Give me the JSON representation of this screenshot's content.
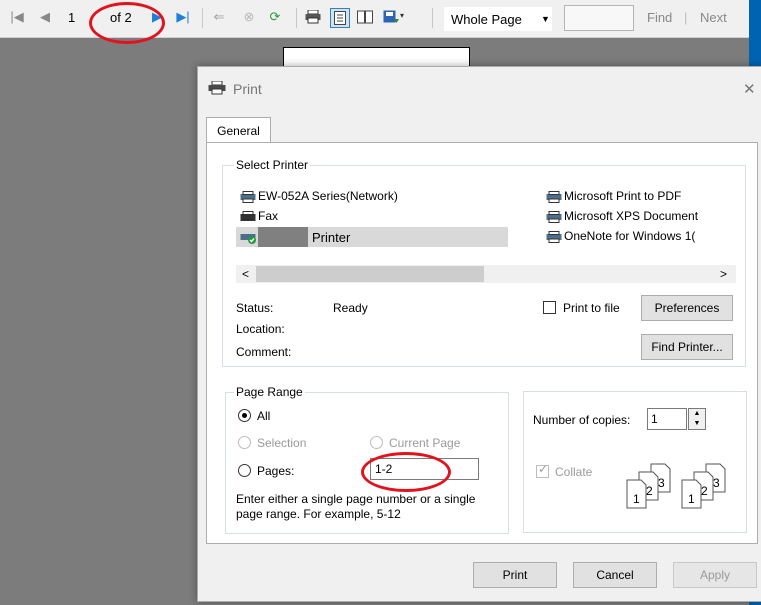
{
  "toolbar": {
    "page_number": "1",
    "page_of": "of 2",
    "zoom_select": "Whole Page",
    "search_value": "",
    "find_label": "Find",
    "separator": "|",
    "next_label": "Next"
  },
  "dialog": {
    "title": "Print",
    "close_glyph": "✕",
    "tab_general": "General",
    "select_printer_group": "Select Printer",
    "printers_left": [
      "EW-052A Series(Network)",
      "Fax",
      "Printer"
    ],
    "printers_right": [
      "Microsoft Print to PDF",
      "Microsoft XPS Document",
      "OneNote for Windows 1("
    ],
    "scroll_left": "<",
    "scroll_right": ">",
    "status_label": "Status:",
    "status_value": "Ready",
    "location_label": "Location:",
    "comment_label": "Comment:",
    "print_to_file_label": "Print to file",
    "preferences_button": "Preferences",
    "find_printer_button": "Find Printer...",
    "page_range_group": "Page Range",
    "range_all": "All",
    "range_selection": "Selection",
    "range_current_page": "Current Page",
    "range_pages": "Pages:",
    "pages_value": "1-2",
    "range_hint_line1": "Enter either a single page number or a single",
    "range_hint_line2": "page range.  For example, 5-12",
    "copies_label": "Number of copies:",
    "copies_value": "1",
    "collate_label": "Collate",
    "print_button": "Print",
    "cancel_button": "Cancel",
    "apply_button": "Apply"
  },
  "colors": {
    "annotation_ring": "#e0141e",
    "selected_printer_bg": "#d9d9d9",
    "accent_blue": "#0063b1"
  }
}
